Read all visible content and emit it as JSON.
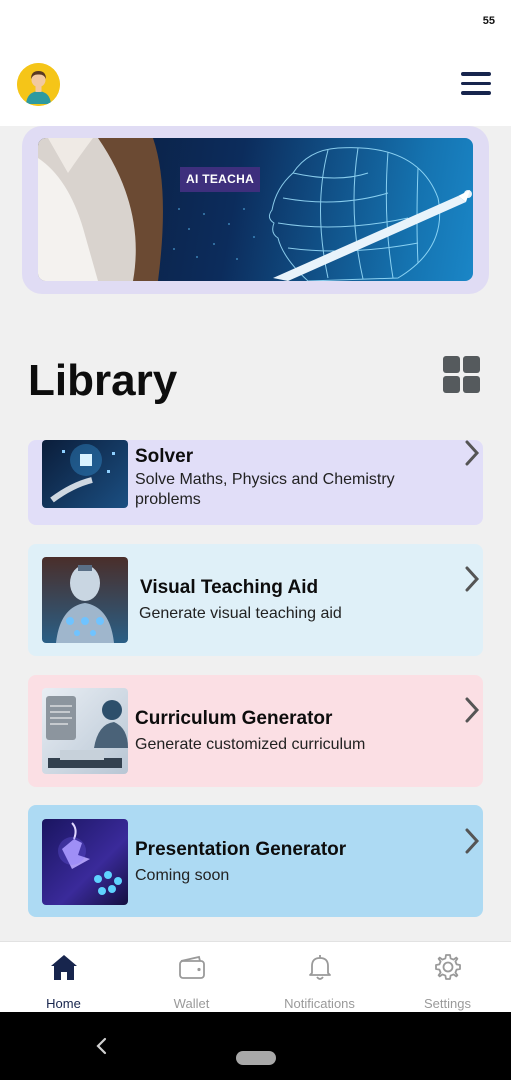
{
  "status_bar": {
    "time": "55"
  },
  "header": {
    "avatar_icon": "user-avatar-icon",
    "menu_icon": "hamburger-menu-icon"
  },
  "banner": {
    "tag": "AI TEACHA"
  },
  "library": {
    "title": "Library",
    "view_icon": "grid-view-icon",
    "items": [
      {
        "title": "Solver",
        "description": "Solve Maths, Physics and Chemistry problems",
        "bg": "#e1def8"
      },
      {
        "title": "Visual Teaching Aid",
        "description": "Generate visual teaching aid",
        "bg": "#dff0f8"
      },
      {
        "title": "Curriculum Generator",
        "description": "Generate customized curriculum",
        "bg": "#fbdfe4"
      },
      {
        "title": "Presentation Generator",
        "description": "Coming soon",
        "bg": "#addaf3"
      }
    ]
  },
  "bottom_nav": {
    "items": [
      {
        "label": "Home",
        "icon": "home-icon",
        "active": true
      },
      {
        "label": "Wallet",
        "icon": "wallet-icon",
        "active": false
      },
      {
        "label": "Notifications",
        "icon": "bell-icon",
        "active": false
      },
      {
        "label": "Settings",
        "icon": "gear-icon",
        "active": false
      }
    ]
  },
  "colors": {
    "primary": "#17254d",
    "inactive": "#9a9a9a",
    "banner_frame": "#e0dcf4"
  }
}
